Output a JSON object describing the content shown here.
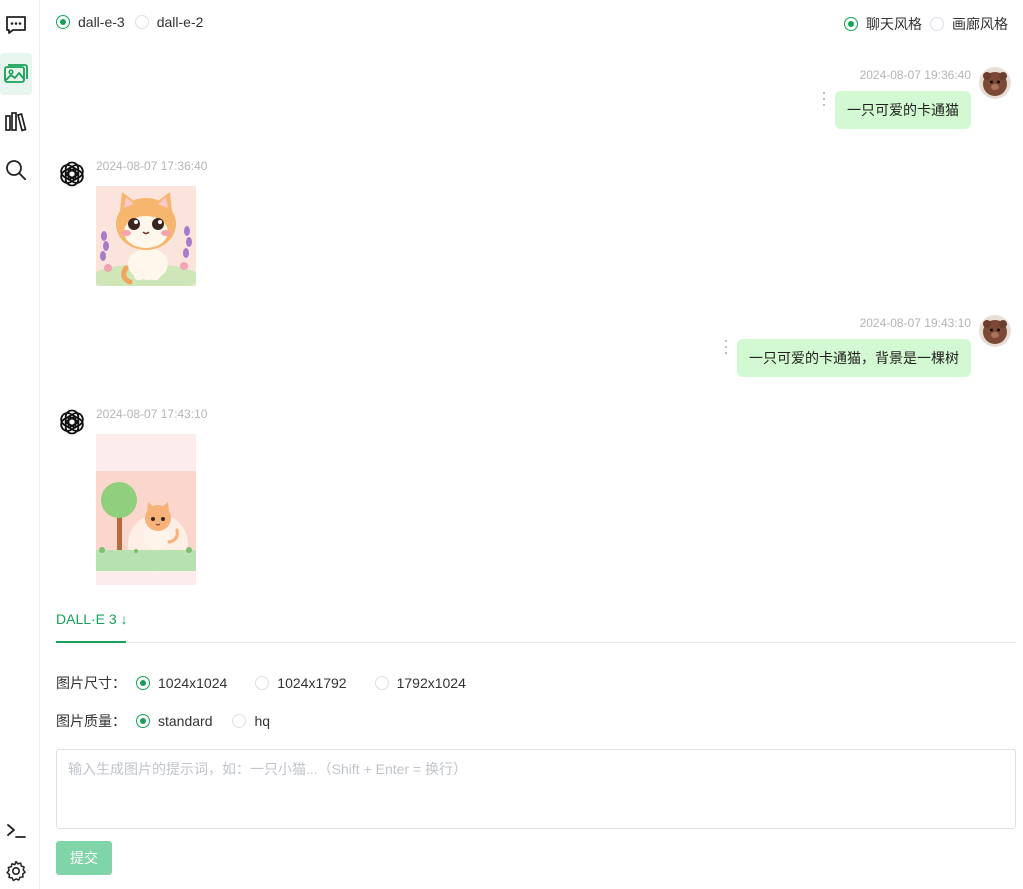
{
  "sidebar": {
    "items": [
      {
        "icon": "chat-icon",
        "active": false
      },
      {
        "icon": "image-gallery-icon",
        "active": true
      },
      {
        "icon": "library-icon",
        "active": false
      },
      {
        "icon": "search-icon",
        "active": false
      }
    ],
    "bottom": [
      {
        "icon": "terminal-icon"
      },
      {
        "icon": "gear-icon"
      }
    ]
  },
  "model_select": {
    "options": [
      {
        "label": "dall-e-3",
        "checked": true
      },
      {
        "label": "dall-e-2",
        "checked": false
      }
    ]
  },
  "style_select": {
    "options": [
      {
        "label": "聊天风格",
        "checked": true
      },
      {
        "label": "画廊风格",
        "checked": false
      }
    ]
  },
  "messages": [
    {
      "role": "user",
      "time": "2024-08-07 19:36:40",
      "text": "一只可爱的卡通猫"
    },
    {
      "role": "assistant",
      "time": "2024-08-07 17:36:40",
      "image": "cute-cartoon-cat-image"
    },
    {
      "role": "user",
      "time": "2024-08-07 19:43:10",
      "text": "一只可爱的卡通猫，背景是一棵树"
    },
    {
      "role": "assistant",
      "time": "2024-08-07 17:43:10",
      "image": "cartoon-cat-with-tree-image"
    }
  ],
  "tabs": [
    {
      "label": "DALL·E 3 ↓",
      "active": true
    }
  ],
  "form": {
    "size_label": "图片尺寸：",
    "size_options": [
      {
        "label": "1024x1024",
        "checked": true
      },
      {
        "label": "1024x1792",
        "checked": false
      },
      {
        "label": "1792x1024",
        "checked": false
      }
    ],
    "quality_label": "图片质量：",
    "quality_options": [
      {
        "label": "standard",
        "checked": true
      },
      {
        "label": "hq",
        "checked": false
      }
    ],
    "prompt_placeholder": "输入生成图片的提示词，如：一只小猫...（Shift + Enter = 换行）",
    "prompt_value": "",
    "submit_label": "提交"
  },
  "colors": {
    "accent": "#18a058",
    "user_bubble": "#d2f9d1",
    "submit_disabled": "#7fd4a8"
  }
}
